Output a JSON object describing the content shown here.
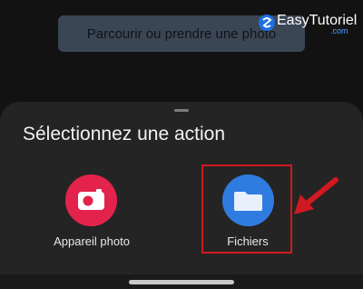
{
  "background_button": {
    "label": "Parcourir ou prendre une photo"
  },
  "watermark": {
    "name": "EasyTutoriel",
    "suffix": ".com"
  },
  "sheet": {
    "title": "Sélectionnez une action",
    "apps": [
      {
        "label": "Appareil photo",
        "icon": "camera-icon",
        "color": "#e3234c"
      },
      {
        "label": "Fichiers",
        "icon": "folder-icon",
        "color": "#2f7ce0"
      }
    ]
  },
  "colors": {
    "highlight": "#d01920",
    "sheet_bg": "#242424",
    "screen_bg": "#121212"
  }
}
